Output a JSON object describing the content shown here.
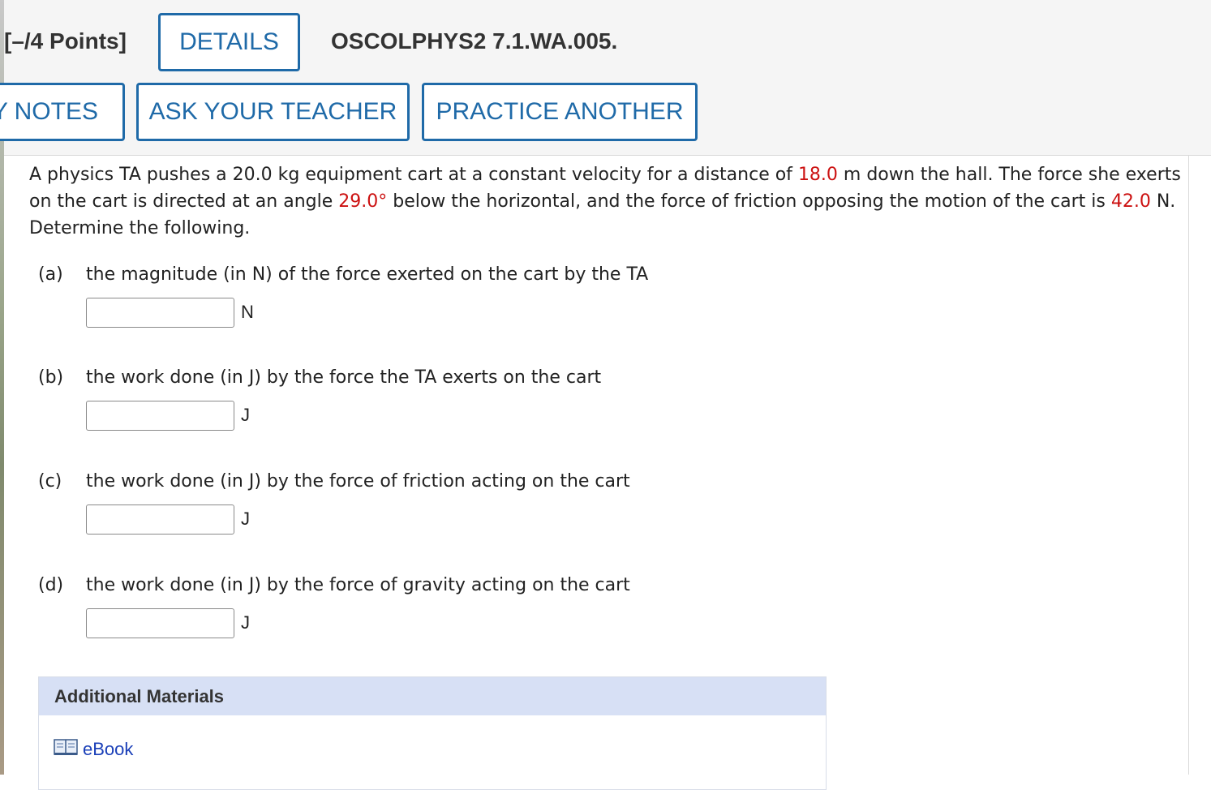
{
  "header": {
    "points": "[–/4 Points]",
    "details_button": "DETAILS",
    "assignment_code": "OSCOLPHYS2 7.1.WA.005.",
    "notes_button": "Y NOTES",
    "ask_teacher_button": "ASK YOUR TEACHER",
    "practice_button": "PRACTICE ANOTHER"
  },
  "problem": {
    "seg1": "A physics TA pushes a 20.0 kg equipment cart at a constant velocity for a distance of ",
    "distance": "18.0",
    "seg2": " m down the hall. The force she exerts on the cart is directed at an angle ",
    "angle": "29.0°",
    "seg3": " below the horizontal, and the force of friction opposing the motion of the cart is ",
    "friction": "42.0",
    "seg4": " N. Determine the following."
  },
  "parts": [
    {
      "label": "(a)",
      "text": "the magnitude (in N) of the force exerted on the cart by the TA",
      "unit": "N",
      "value": ""
    },
    {
      "label": "(b)",
      "text": "the work done (in J) by the force the TA exerts on the cart",
      "unit": "J",
      "value": ""
    },
    {
      "label": "(c)",
      "text": "the work done (in J) by the force of friction acting on the cart",
      "unit": "J",
      "value": ""
    },
    {
      "label": "(d)",
      "text": "the work done (in J) by the force of gravity acting on the cart",
      "unit": "J",
      "value": ""
    }
  ],
  "materials": {
    "title": "Additional Materials",
    "ebook_label": "eBook",
    "ebook_icon": "book-icon"
  },
  "colors": {
    "accent": "#1f6aa8",
    "highlight": "#cc1111",
    "materials_header": "#d7e0f5",
    "link": "#1a3fb8"
  }
}
